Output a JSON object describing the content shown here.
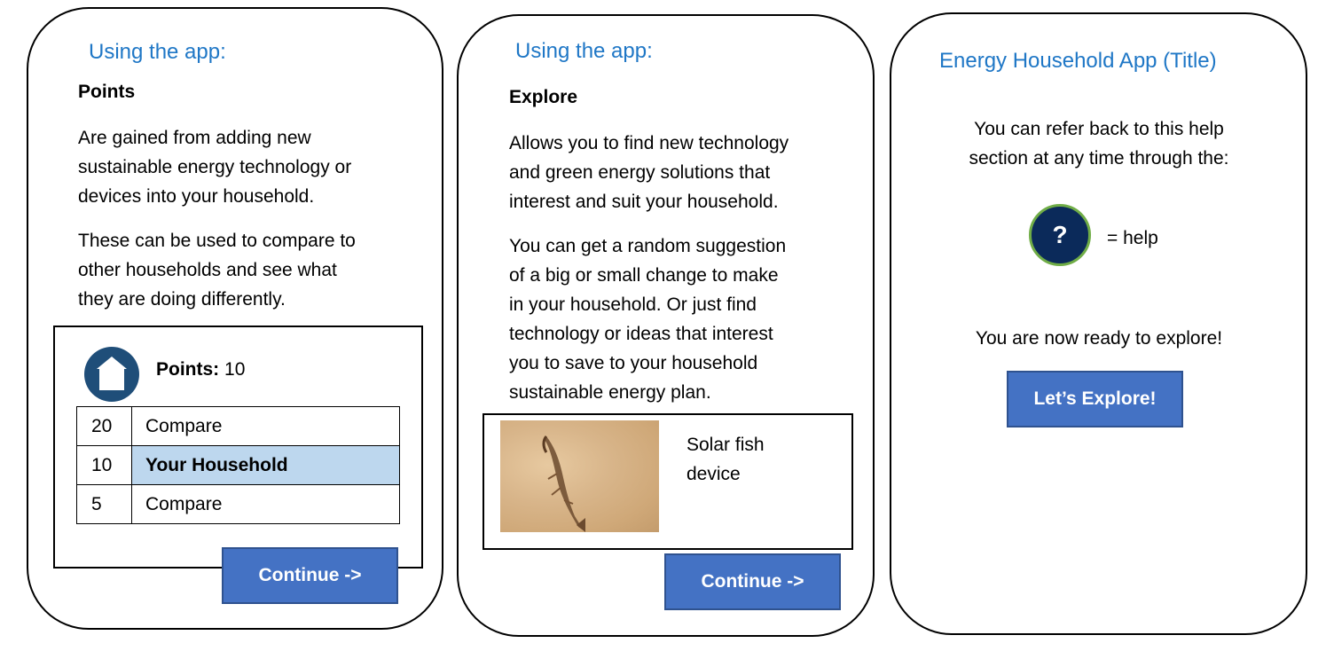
{
  "screen1": {
    "title": "Using the app:",
    "heading": "Points",
    "para1": [
      "Are gained from adding new",
      "sustainable energy technology or",
      "devices into your household."
    ],
    "para2": [
      "These can be used to compare to",
      "other households and see what",
      "they are doing differently."
    ],
    "points_label": "Points:",
    "points_value": "10",
    "home_icon": "house-icon",
    "rows": [
      {
        "value": "20",
        "label": "Compare"
      },
      {
        "value": "10",
        "label": "Your Household"
      },
      {
        "value": "5",
        "label": "Compare"
      }
    ],
    "continue_label": "Continue ->"
  },
  "screen2": {
    "title": "Using the app:",
    "heading": "Explore",
    "para1": [
      "Allows you to find new technology",
      "and green energy solutions that",
      "interest and suit your household."
    ],
    "para2": [
      "You can get a random suggestion",
      "of a big or small change to make",
      "in your household. Or just find",
      "technology or ideas that interest",
      "you to save to your household",
      "sustainable energy plan."
    ],
    "device_name": [
      "Solar fish",
      "device"
    ],
    "continue_label": "Continue ->"
  },
  "screen3": {
    "title": "Energy Household App (Title)",
    "para1": [
      "You can refer back to this help",
      "section at any time through the:"
    ],
    "help_symbol": "?",
    "help_label": "= help",
    "ready_text": "You are now ready to explore!",
    "explore_label": "Let’s Explore!"
  },
  "colors": {
    "title_blue": "#1f77c6",
    "button_blue": "#4472c4",
    "highlight": "#bdd7ee",
    "home_circle": "#1f4e79",
    "help_circle": "#0b2a5a",
    "help_border": "#70ad47"
  }
}
